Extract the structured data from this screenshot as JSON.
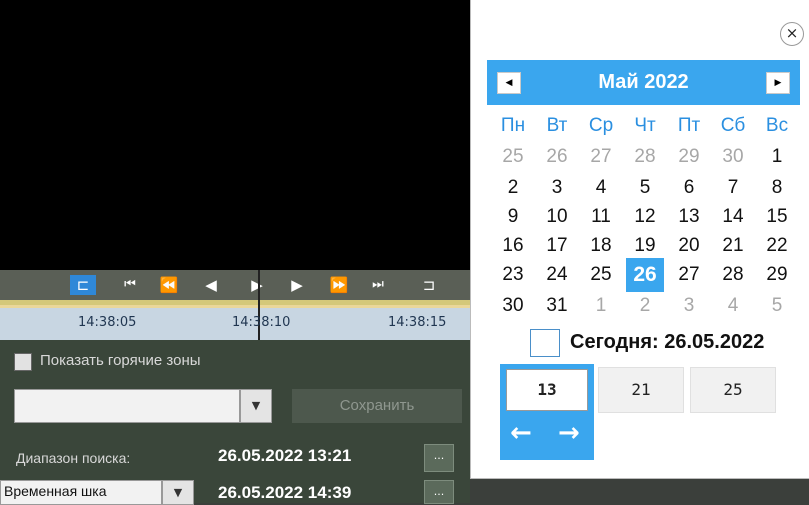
{
  "timeline": {
    "labels": [
      "14:38:05",
      "14:38:10",
      "14:38:15"
    ]
  },
  "panel": {
    "hotzones_label": "Показать горячие зоны",
    "save_label": "Сохранить",
    "search_range_label": "Диапазон поиска:",
    "range_start": "26.05.2022 13:21",
    "range_end": "26.05.2022 14:39",
    "range_mode_value": "Временная шка",
    "dots": "..."
  },
  "calendar": {
    "close": "×",
    "month_title": "Май 2022",
    "prev": "◀",
    "next": "▶",
    "weekdays": [
      "Пн",
      "Вт",
      "Ср",
      "Чт",
      "Пт",
      "Сб",
      "Вс"
    ],
    "weeks": [
      [
        [
          "25",
          true
        ],
        [
          "26",
          true
        ],
        [
          "27",
          true
        ],
        [
          "28",
          true
        ],
        [
          "29",
          true
        ],
        [
          "30",
          true
        ],
        [
          "1",
          false
        ]
      ],
      [
        [
          "2",
          false
        ],
        [
          "3",
          false
        ],
        [
          "4",
          false
        ],
        [
          "5",
          false
        ],
        [
          "6",
          false
        ],
        [
          "7",
          false
        ],
        [
          "8",
          false
        ]
      ],
      [
        [
          "9",
          false
        ],
        [
          "10",
          false
        ],
        [
          "11",
          false
        ],
        [
          "12",
          false
        ],
        [
          "13",
          false
        ],
        [
          "14",
          false
        ],
        [
          "15",
          false
        ]
      ],
      [
        [
          "16",
          false
        ],
        [
          "17",
          false
        ],
        [
          "18",
          false
        ],
        [
          "19",
          false
        ],
        [
          "20",
          false
        ],
        [
          "21",
          false
        ],
        [
          "22",
          false
        ]
      ],
      [
        [
          "23",
          false
        ],
        [
          "24",
          false
        ],
        [
          "25",
          false
        ],
        [
          "26",
          false
        ],
        [
          "27",
          false
        ],
        [
          "28",
          false
        ],
        [
          "29",
          false
        ]
      ],
      [
        [
          "30",
          false
        ],
        [
          "31",
          false
        ],
        [
          "1",
          true
        ],
        [
          "2",
          true
        ],
        [
          "3",
          true
        ],
        [
          "4",
          true
        ],
        [
          "5",
          true
        ]
      ]
    ],
    "selected_day": "26",
    "today_label": "Сегодня: 26.05.2022",
    "times": [
      "13",
      "21",
      "25"
    ],
    "arrow_left": "←",
    "arrow_right": "→"
  },
  "colors": {
    "accent": "#3aa6ee"
  }
}
